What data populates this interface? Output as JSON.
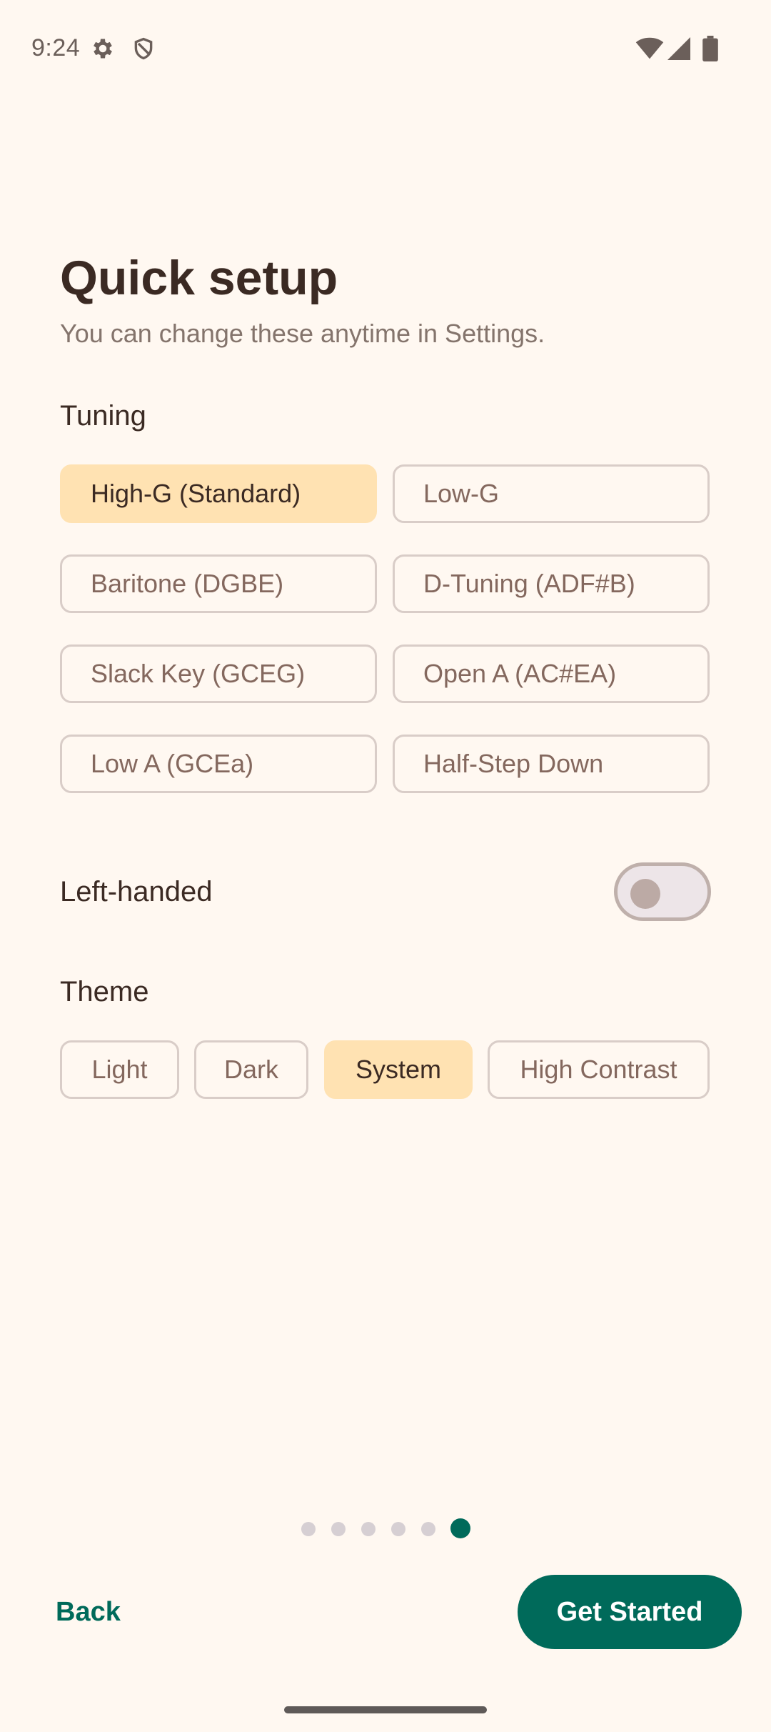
{
  "status_bar": {
    "time": "9:24",
    "icons": [
      "gear-icon",
      "shield-icon",
      "wifi-icon",
      "cellular-signal-icon",
      "battery-icon"
    ]
  },
  "header": {
    "title": "Quick setup",
    "subtitle": "You can change these anytime in Settings."
  },
  "tuning": {
    "label": "Tuning",
    "options": [
      {
        "label": "High-G (Standard)",
        "selected": true
      },
      {
        "label": "Low-G",
        "selected": false
      },
      {
        "label": "Baritone (DGBE)",
        "selected": false
      },
      {
        "label": "D-Tuning (ADF#B)",
        "selected": false
      },
      {
        "label": "Slack Key (GCEG)",
        "selected": false
      },
      {
        "label": "Open A (AC#EA)",
        "selected": false
      },
      {
        "label": "Low A (GCEa)",
        "selected": false
      },
      {
        "label": "Half-Step Down",
        "selected": false
      }
    ]
  },
  "left_handed": {
    "label": "Left-handed",
    "enabled": false
  },
  "theme": {
    "label": "Theme",
    "options": [
      {
        "label": "Light",
        "selected": false
      },
      {
        "label": "Dark",
        "selected": false
      },
      {
        "label": "System",
        "selected": true
      },
      {
        "label": "High Contrast",
        "selected": false
      }
    ]
  },
  "pager": {
    "total": 6,
    "current": 6
  },
  "footer": {
    "back_label": "Back",
    "primary_label": "Get Started"
  },
  "colors": {
    "background": "#FFF8F1",
    "accent": "#006A5A",
    "selected_chip": "#FFE2B2",
    "text": "#3B2A23"
  }
}
